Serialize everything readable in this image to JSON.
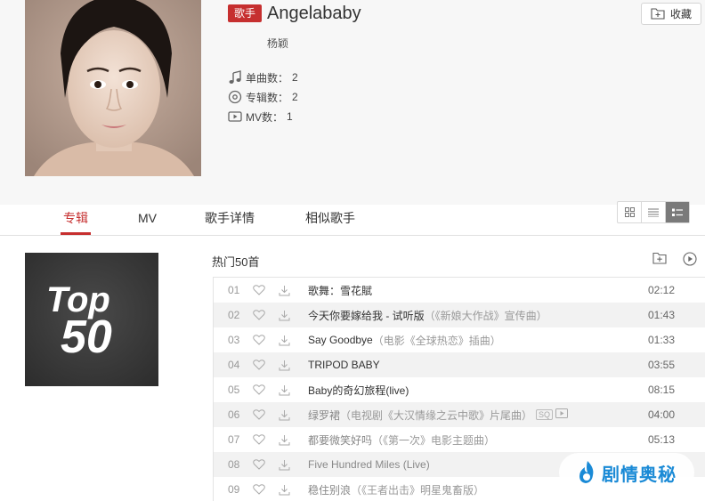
{
  "artist": {
    "badge": "歌手",
    "name": "Angelababy",
    "alias": "杨颖",
    "stats": [
      {
        "label": "单曲数：",
        "value": "2",
        "icon": "music-note-icon"
      },
      {
        "label": "专辑数：",
        "value": "2",
        "icon": "album-disc-icon"
      },
      {
        "label": "MV数：",
        "value": "1",
        "icon": "mv-icon"
      }
    ],
    "favorite_label": "收藏"
  },
  "tabs": [
    {
      "label": "专辑",
      "active": true
    },
    {
      "label": "MV",
      "active": false
    },
    {
      "label": "歌手详情",
      "active": false
    },
    {
      "label": "相似歌手",
      "active": false
    }
  ],
  "view_modes": [
    {
      "icon": "grid-view-icon",
      "active": false
    },
    {
      "icon": "list-view-icon",
      "active": false
    },
    {
      "icon": "detail-view-icon",
      "active": true
    }
  ],
  "top50": {
    "cover_line1": "Top",
    "cover_line2": "50",
    "title": "热门50首",
    "songs": [
      {
        "num": "01",
        "title": "歌舞：雪花賦",
        "extra": "",
        "duration": "02:12",
        "dim": false
      },
      {
        "num": "02",
        "title": "今天你要嫁给我 - 试听版",
        "extra": "（《新娘大作战》宣传曲）",
        "duration": "01:43",
        "dim": false
      },
      {
        "num": "03",
        "title": "Say Goodbye",
        "extra": "（电影《全球热恋》插曲）",
        "duration": "01:33",
        "dim": false
      },
      {
        "num": "04",
        "title": "TRIPOD BABY",
        "extra": "",
        "duration": "03:55",
        "dim": false
      },
      {
        "num": "05",
        "title": "Baby的奇幻旅程(live)",
        "extra": "",
        "duration": "08:15",
        "dim": false
      },
      {
        "num": "06",
        "title": "绿罗裙",
        "extra": "（电视剧《大汉情缘之云中歌》片尾曲）",
        "duration": "04:00",
        "dim": true,
        "tag": "SQ"
      },
      {
        "num": "07",
        "title": "都要微笑好吗",
        "extra": "（《第一次》电影主题曲）",
        "duration": "05:13",
        "dim": true
      },
      {
        "num": "08",
        "title": "Five Hundred Miles (Live)",
        "extra": "",
        "duration": "",
        "dim": true
      },
      {
        "num": "09",
        "title": "稳住别浪",
        "extra": "（《王者出击》明星鬼畜版）",
        "duration": "",
        "dim": true
      }
    ]
  },
  "watermark": "剧情奥秘",
  "colors": {
    "accent": "#c62f2f",
    "watermark": "#1a8ad6"
  }
}
